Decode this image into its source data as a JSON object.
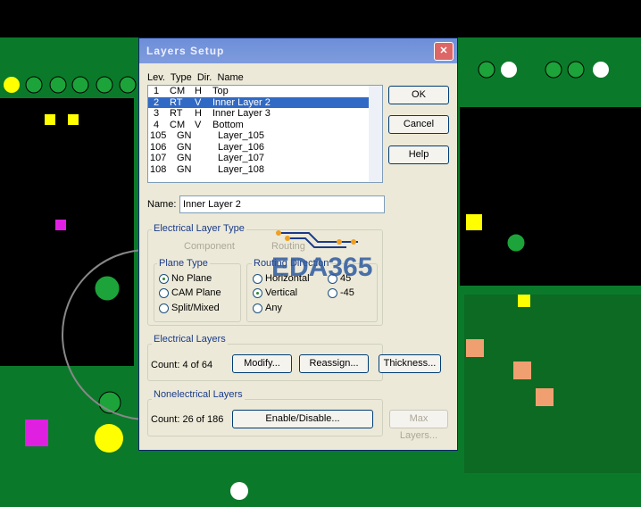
{
  "dialog": {
    "title": "Layers Setup",
    "close": "✕"
  },
  "list": {
    "headers": "Lev.  Type  Dir.  Name",
    "rows": [
      {
        "lev": "1",
        "type": "CM",
        "dir": "H",
        "name": "Top"
      },
      {
        "lev": "2",
        "type": "RT",
        "dir": "V",
        "name": "Inner Layer 2"
      },
      {
        "lev": "3",
        "type": "RT",
        "dir": "H",
        "name": "Inner Layer 3"
      },
      {
        "lev": "4",
        "type": "CM",
        "dir": "V",
        "name": "Bottom"
      },
      {
        "lev": "105",
        "type": "GN",
        "dir": "",
        "name": "Layer_105"
      },
      {
        "lev": "106",
        "type": "GN",
        "dir": "",
        "name": "Layer_106"
      },
      {
        "lev": "107",
        "type": "GN",
        "dir": "",
        "name": "Layer_107"
      },
      {
        "lev": "108",
        "type": "GN",
        "dir": "",
        "name": "Layer_108"
      }
    ],
    "selected_index": 1
  },
  "buttons": {
    "ok": "OK",
    "cancel": "Cancel",
    "help": "Help",
    "modify": "Modify...",
    "reassign": "Reassign...",
    "thickness": "Thickness...",
    "enable": "Enable/Disable...",
    "max": "Max Layers..."
  },
  "name": {
    "label": "Name:",
    "value": "Inner Layer 2"
  },
  "elec_type": {
    "label": "Electrical Layer Type",
    "component": "Component",
    "routing": "Routing"
  },
  "plane": {
    "label": "Plane Type",
    "no": "No Plane",
    "cam": "CAM Plane",
    "split": "Split/Mixed"
  },
  "routing": {
    "label": "Routing Direction",
    "h": "Horizontal",
    "v": "Vertical",
    "any": "Any",
    "p45": "45",
    "m45": "-45"
  },
  "electrical": {
    "label": "Electrical Layers",
    "count": "Count:  4 of 64"
  },
  "nonelectrical": {
    "label": "Nonelectrical Layers",
    "count": "Count: 26 of 186"
  },
  "watermark": "EDA365"
}
